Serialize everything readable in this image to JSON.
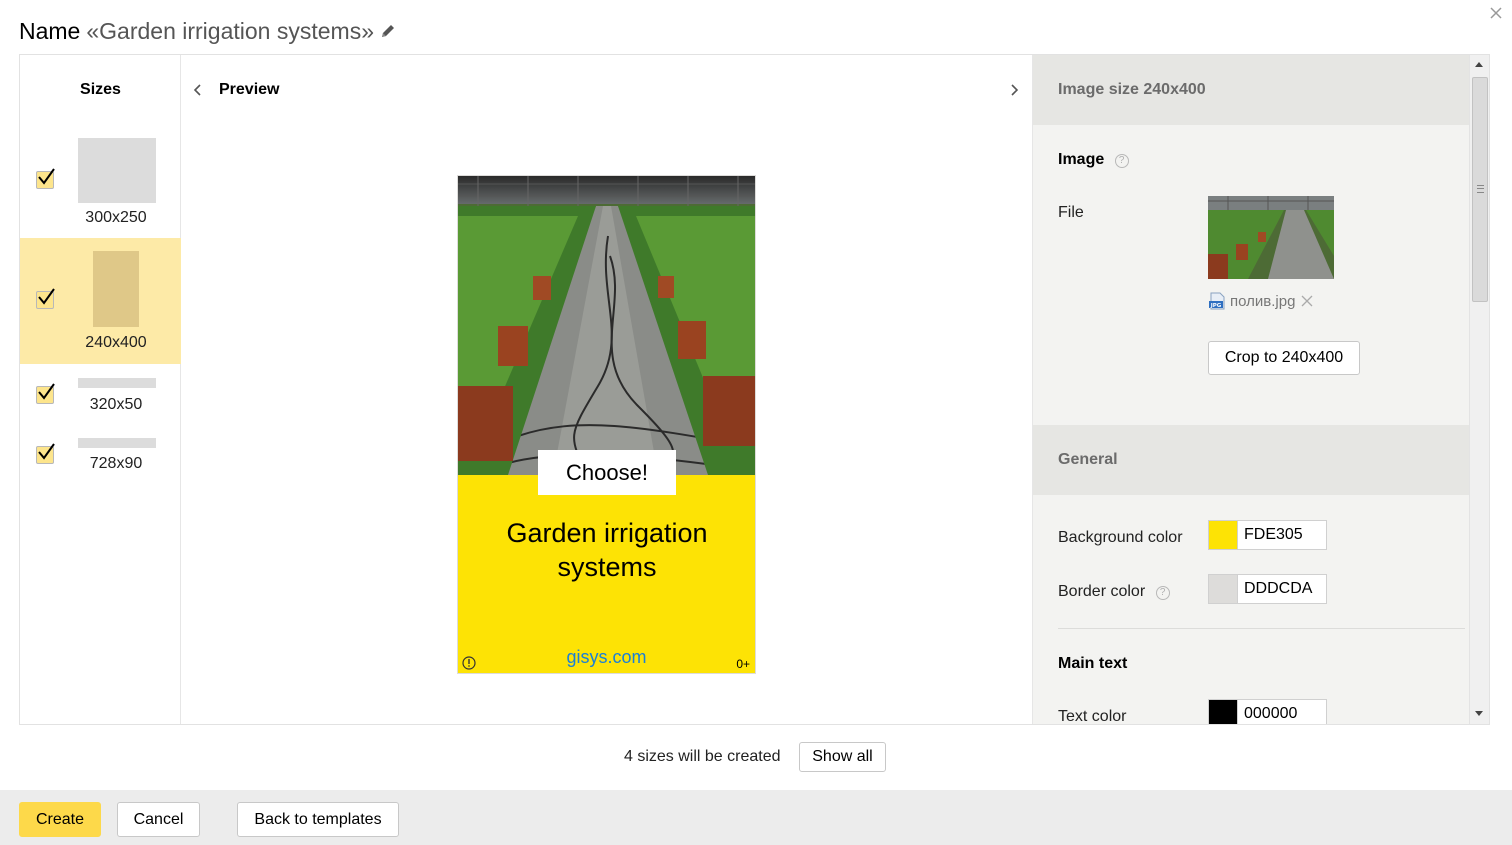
{
  "header": {
    "name_label": "Name",
    "name_value": "«Garden irrigation systems»"
  },
  "sizes": {
    "title": "Sizes",
    "items": [
      {
        "label": "300x250",
        "checked": true,
        "active": false
      },
      {
        "label": "240x400",
        "checked": true,
        "active": true
      },
      {
        "label": "320x50",
        "checked": true,
        "active": false
      },
      {
        "label": "728x90",
        "checked": true,
        "active": false
      }
    ]
  },
  "preview": {
    "title": "Preview",
    "ad": {
      "button_text": "Choose!",
      "main_text": "Garden irrigation systems",
      "domain": "gisys.com",
      "age": "0+",
      "background_color": "#FDE305",
      "border_color": "#DDDCDA",
      "text_color": "#000000"
    }
  },
  "settings": {
    "image_section_title": "Image size 240x400",
    "image_label": "Image",
    "file_label": "File",
    "file_name": "полив.jpg",
    "crop_button": "Crop to 240x400",
    "general_title": "General",
    "background_color_label": "Background color",
    "background_color_value": "FDE305",
    "border_color_label": "Border color",
    "border_color_value": "DDDCDA",
    "main_text_title": "Main text",
    "text_color_label": "Text color",
    "text_color_value": "000000"
  },
  "summary": {
    "text": "4 sizes will be created",
    "show_all": "Show all"
  },
  "footer": {
    "create": "Create",
    "cancel": "Cancel",
    "back": "Back to templates"
  },
  "icons": {
    "help": "?"
  }
}
